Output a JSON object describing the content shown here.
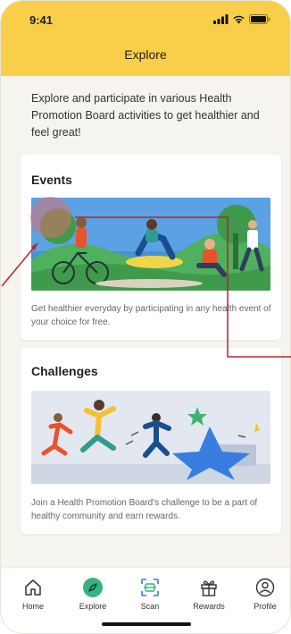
{
  "status_bar": {
    "time": "9:41"
  },
  "header": {
    "title": "Explore"
  },
  "intro": {
    "text": "Explore and participate in various Health Promotion Board activities to get healthier and feel great!"
  },
  "cards": [
    {
      "title": "Events",
      "image": "events-illustration",
      "description": "Get healthier everyday by participating in any health event of your choice for free."
    },
    {
      "title": "Challenges",
      "image": "challenges-illustration",
      "description": "Join a Health Promotion Board's challenge to be a part of healthy community and earn rewards."
    }
  ],
  "nav": {
    "items": [
      {
        "label": "Home",
        "icon": "home-icon"
      },
      {
        "label": "Explore",
        "icon": "compass-icon",
        "active": true
      },
      {
        "label": "Scan",
        "icon": "scan-icon"
      },
      {
        "label": "Rewards",
        "icon": "gift-icon"
      },
      {
        "label": "Profile",
        "icon": "profile-icon"
      }
    ]
  },
  "colors": {
    "header": "#f9cf4a",
    "accent": "#37b37e",
    "scan": "#2f7be0",
    "annotation": "#c0202a"
  }
}
